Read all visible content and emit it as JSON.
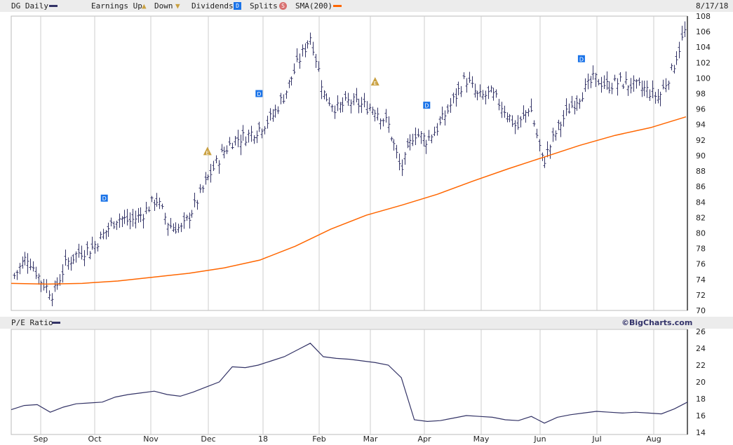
{
  "header": {
    "symbol_label": "DG Daily",
    "earnings_label": "Earnings Up",
    "down_label": "Down",
    "dividends_label": "Dividends",
    "splits_label": "Splits",
    "sma_label": "SMA(200)",
    "date": "8/17/18",
    "price_color": "#333366",
    "sma_color": "#ff6600"
  },
  "lower_header": {
    "label": "P/E Ratio",
    "credit": "©BigCharts.com"
  },
  "chart_data": [
    {
      "type": "ohlc",
      "title": "DG Daily",
      "ylim": [
        70,
        108
      ],
      "yticks": [
        70,
        72,
        74,
        76,
        78,
        80,
        82,
        84,
        86,
        88,
        90,
        92,
        94,
        96,
        98,
        100,
        102,
        104,
        106,
        108
      ],
      "xticks": [
        "Sep",
        "Oct",
        "Nov",
        "Dec",
        "18",
        "Feb",
        "Mar",
        "Apr",
        "May",
        "Jun",
        "Jul",
        "Aug"
      ],
      "weekly_close": [
        74.5,
        77,
        74,
        72,
        76,
        77.5,
        78,
        80,
        82,
        81.5,
        82.5,
        84.5,
        81,
        80.5,
        83.5,
        87,
        90,
        92,
        92.5,
        93.5,
        95,
        98,
        102,
        105.5,
        98,
        96,
        97,
        96.5,
        96,
        94,
        88,
        93,
        92,
        94,
        97,
        100,
        97.5,
        98,
        96,
        93.5,
        96.5,
        89,
        93,
        96,
        98,
        100,
        99,
        99.5,
        99,
        98.5,
        97.5,
        101,
        106
      ],
      "sma200": [
        73.5,
        73.4,
        73.5,
        73.8,
        74.3,
        74.8,
        75.5,
        76.5,
        78.3,
        80.5,
        82.3,
        83.6,
        85,
        86.7,
        88.3,
        89.8,
        91.3,
        92.6,
        93.6,
        95
      ],
      "dividend_markers": [
        {
          "week": 7,
          "label": "D"
        },
        {
          "week": 19,
          "label": "D"
        },
        {
          "week": 32,
          "label": "D"
        },
        {
          "week": 44,
          "label": "D"
        }
      ],
      "earnings_markers": [
        {
          "week": 15,
          "label": "E"
        },
        {
          "week": 28,
          "label": "E"
        }
      ]
    },
    {
      "type": "line",
      "title": "P/E Ratio",
      "ylim": [
        14,
        26
      ],
      "yticks": [
        14,
        16,
        18,
        20,
        22,
        24,
        26
      ],
      "values": [
        16.7,
        17.2,
        17.3,
        16.4,
        17,
        17.4,
        17.5,
        17.6,
        18.2,
        18.5,
        18.7,
        18.9,
        18.5,
        18.3,
        18.8,
        19.4,
        20,
        21.8,
        21.7,
        22,
        22.5,
        23,
        23.8,
        24.6,
        23,
        22.8,
        22.7,
        22.5,
        22.3,
        22,
        20.5,
        15.5,
        15.3,
        15.4,
        15.7,
        16,
        15.9,
        15.8,
        15.5,
        15.4,
        15.9,
        15.1,
        15.8,
        16.1,
        16.3,
        16.5,
        16.4,
        16.3,
        16.4,
        16.3,
        16.2,
        16.8,
        17.6
      ]
    }
  ]
}
